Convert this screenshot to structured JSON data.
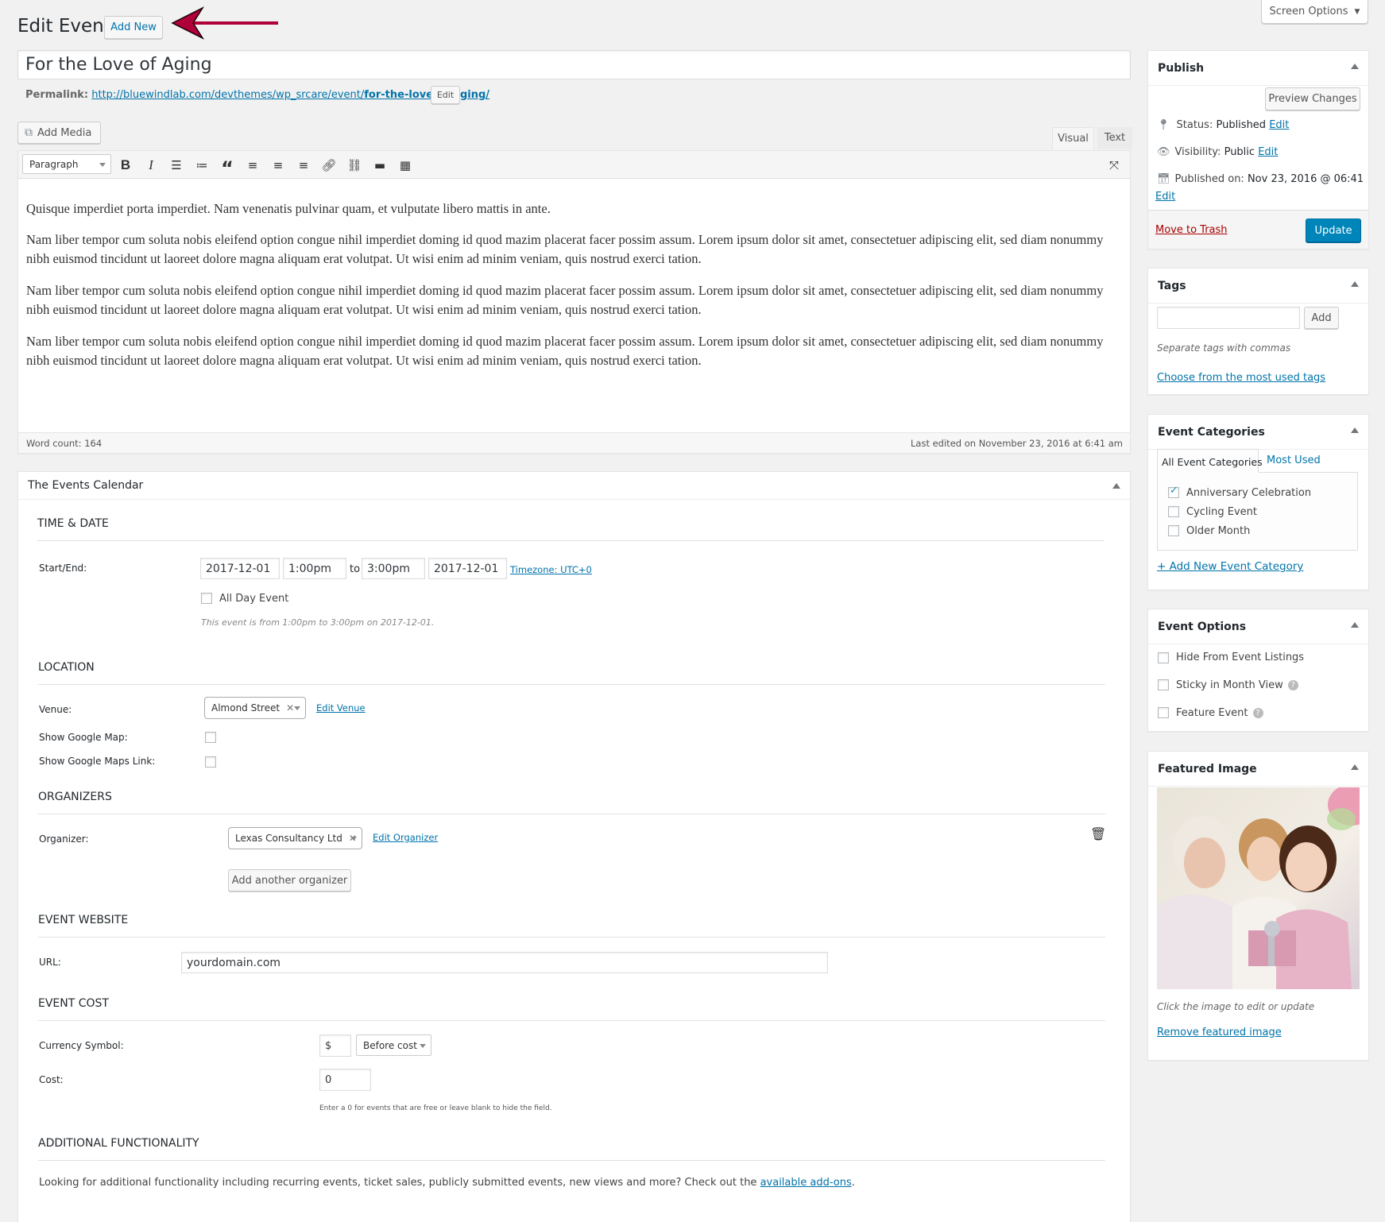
{
  "screen_options": "Screen Options",
  "header": {
    "title": "Edit Event",
    "add_new": "Add New"
  },
  "post_title": "For the Love of Aging",
  "permalink": {
    "label": "Permalink:",
    "url_base": "http://bluewindlab.com/devthemes/wp_srcare/event/",
    "slug": "for-the-love-of-aging/",
    "edit": "Edit"
  },
  "editor": {
    "add_media": "Add Media",
    "tab_visual": "Visual",
    "tab_text": "Text",
    "format_select": "Paragraph",
    "paragraphs": [
      "Quisque imperdiet porta imperdiet. Nam venenatis pulvinar quam, et vulputate libero mattis in ante.",
      "Nam liber tempor cum soluta nobis eleifend option congue nihil imperdiet doming id quod mazim placerat facer possim assum. Lorem ipsum dolor sit amet, consectetuer adipiscing elit, sed diam nonummy nibh euismod tincidunt ut laoreet dolore magna aliquam erat volutpat. Ut wisi enim ad minim veniam, quis nostrud exerci tation.",
      "Nam liber tempor cum soluta nobis eleifend option congue nihil imperdiet doming id quod mazim placerat facer possim assum. Lorem ipsum dolor sit amet, consectetuer adipiscing elit, sed diam nonummy nibh euismod tincidunt ut laoreet dolore magna aliquam erat volutpat. Ut wisi enim ad minim veniam, quis nostrud exerci tation.",
      "Nam liber tempor cum soluta nobis eleifend option congue nihil imperdiet doming id quod mazim placerat facer possim assum. Lorem ipsum dolor sit amet, consectetuer adipiscing elit, sed diam nonummy nibh euismod tincidunt ut laoreet dolore magna aliquam erat volutpat. Ut wisi enim ad minim veniam, quis nostrud exerci tation."
    ],
    "word_count": "Word count: 164",
    "last_edited": "Last edited on November 23, 2016 at 6:41 am"
  },
  "events_calendar": {
    "title": "The Events Calendar",
    "time_date": {
      "heading": "TIME & DATE",
      "start_end_label": "Start/End:",
      "start_date": "2017-12-01",
      "start_time": "1:00pm",
      "to": "to",
      "end_time": "3:00pm",
      "end_date": "2017-12-01",
      "timezone": "Timezone: UTC+0",
      "all_day": "All Day Event",
      "note": "This event is from 1:00pm to 3:00pm on 2017-12-01."
    },
    "location": {
      "heading": "LOCATION",
      "venue_label": "Venue:",
      "venue_value": "Almond Street",
      "edit_venue": "Edit Venue",
      "show_map": "Show Google Map:",
      "show_map_link": "Show Google Maps Link:"
    },
    "organizers": {
      "heading": "ORGANIZERS",
      "organizer_label": "Organizer:",
      "organizer_value": "Lexas Consultancy Ltd",
      "edit_organizer": "Edit Organizer",
      "add_another": "Add another organizer"
    },
    "website": {
      "heading": "EVENT WEBSITE",
      "url_label": "URL:",
      "url_value": "yourdomain.com"
    },
    "cost": {
      "heading": "EVENT COST",
      "currency_label": "Currency Symbol:",
      "currency_value": "$",
      "position_value": "Before cost",
      "cost_label": "Cost:",
      "cost_value": "0",
      "note": "Enter a 0 for events that are free or leave blank to hide the field."
    },
    "additional": {
      "heading": "ADDITIONAL FUNCTIONALITY",
      "text": "Looking for additional functionality including recurring events, ticket sales, publicly submitted events, new views and more? Check out the ",
      "link": "available add-ons",
      "end": "."
    }
  },
  "publish": {
    "title": "Publish",
    "preview": "Preview Changes",
    "status_label": "Status:",
    "status_value": "Published",
    "visibility_label": "Visibility:",
    "visibility_value": "Public",
    "published_label": "Published on:",
    "published_value": "Nov 23, 2016 @ 06:41",
    "edit": "Edit",
    "trash": "Move to Trash",
    "update": "Update"
  },
  "tags": {
    "title": "Tags",
    "add": "Add",
    "hint": "Separate tags with commas",
    "choose": "Choose from the most used tags"
  },
  "event_categories": {
    "title": "Event Categories",
    "tab_all": "All Event Categories",
    "tab_most": "Most Used",
    "items": [
      {
        "label": "Anniversary Celebration",
        "checked": true
      },
      {
        "label": "Cycling Event",
        "checked": false
      },
      {
        "label": "Older Month",
        "checked": false
      }
    ],
    "add_new": "+ Add New Event Category"
  },
  "event_options": {
    "title": "Event Options",
    "hide": "Hide From Event Listings",
    "sticky": "Sticky in Month View",
    "feature": "Feature Event"
  },
  "featured_image": {
    "title": "Featured Image",
    "hint": "Click the image to edit or update",
    "remove": "Remove featured image"
  },
  "colors": {
    "accent": "#0073aa",
    "update_btn": "#0085ba",
    "trash": "#a00",
    "arrow": "#b0003a"
  }
}
